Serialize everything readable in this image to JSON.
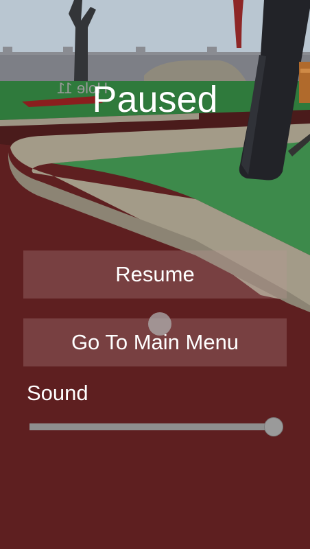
{
  "pause_menu": {
    "title": "Paused",
    "resume_label": "Resume",
    "main_menu_label": "Go To Main Menu",
    "sound_label": "Sound",
    "sound_volume": 1.0
  },
  "scene": {
    "hole_sign": "Hole 11"
  },
  "colors": {
    "background": "#5e1f20",
    "grass": "#3d8a4b",
    "wall": "#a39b88",
    "button": "#be9696",
    "slider": "#8e8e8e"
  }
}
